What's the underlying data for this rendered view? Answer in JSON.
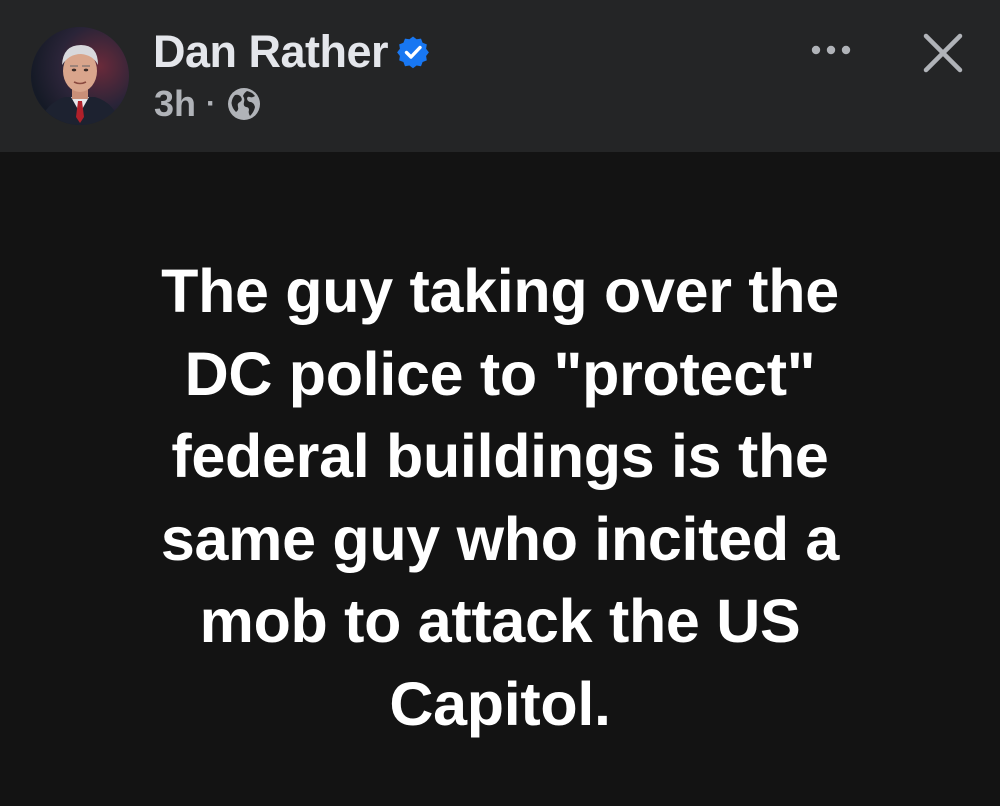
{
  "post": {
    "author": {
      "name": "Dan Rather",
      "verified": true,
      "avatar_icon": "profile-photo"
    },
    "meta": {
      "timestamp": "3h",
      "separator": "·",
      "audience_icon": "globe-icon"
    },
    "actions": {
      "more_icon": "more-horizontal-icon",
      "close_icon": "close-icon"
    },
    "text_lines": [
      "The guy taking over the",
      "DC police to \"protect\"",
      "federal buildings is the",
      "same guy who incited a",
      "mob to attack the US",
      "Capitol."
    ]
  },
  "colors": {
    "header_bg": "#242526",
    "body_bg": "#131313",
    "name_text": "#e4e6eb",
    "meta_text": "#b0b3b8",
    "verified_blue": "#1877f2",
    "post_text": "#ffffff"
  }
}
